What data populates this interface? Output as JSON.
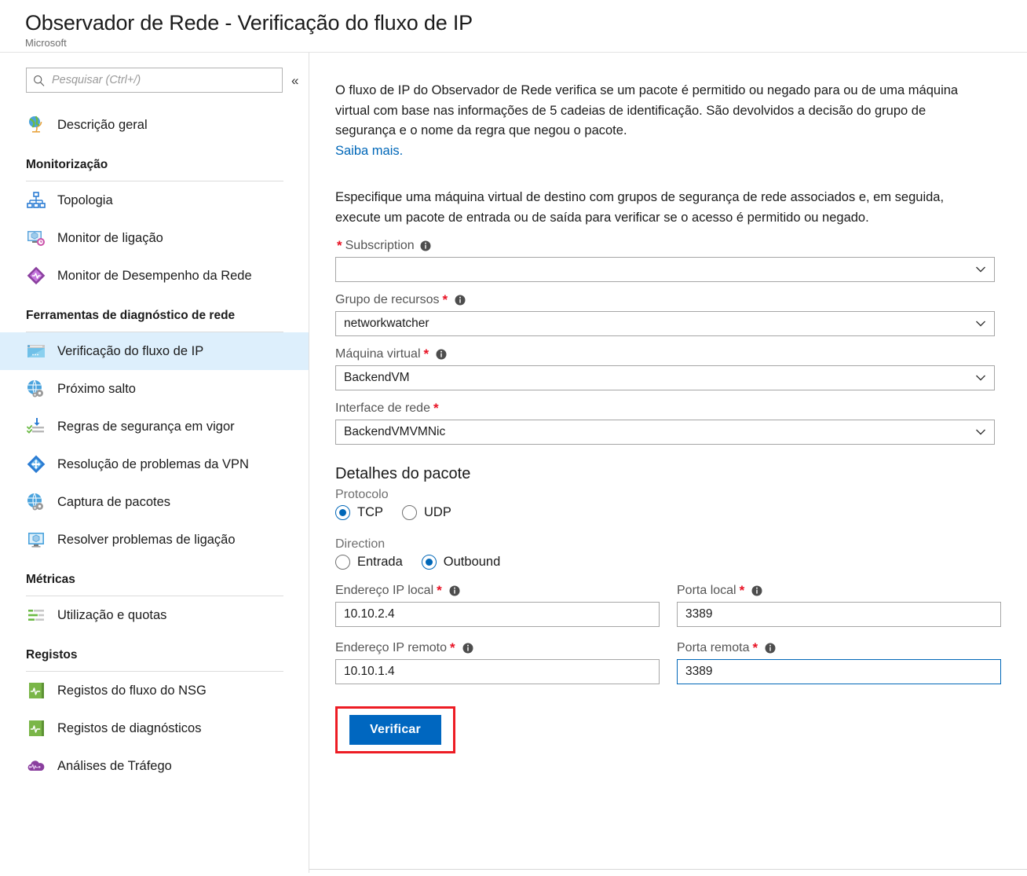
{
  "header": {
    "title": "Observador de Rede - Verificação do fluxo de IP",
    "subtitle": "Microsoft"
  },
  "search": {
    "placeholder": "Pesquisar (Ctrl+/)",
    "icon": "search-icon",
    "collapse_glyph": "«"
  },
  "sidebar": {
    "overview": {
      "label": "Descrição geral",
      "icon": "globe-icon"
    },
    "sections": [
      {
        "title": "Monitorização",
        "items": [
          {
            "label": "Topologia",
            "icon": "topology-icon"
          },
          {
            "label": "Monitor de ligação",
            "icon": "connection-monitor-icon"
          },
          {
            "label": "Monitor de Desempenho da Rede",
            "icon": "network-performance-icon"
          }
        ]
      },
      {
        "title": "Ferramentas de diagnóstico de rede",
        "items": [
          {
            "label": "Verificação do fluxo de IP",
            "icon": "ip-flow-verify-icon",
            "selected": true
          },
          {
            "label": "Próximo salto",
            "icon": "next-hop-icon"
          },
          {
            "label": "Regras de segurança em vigor",
            "icon": "effective-security-rules-icon"
          },
          {
            "label": "Resolução de problemas da VPN",
            "icon": "vpn-troubleshoot-icon"
          },
          {
            "label": "Captura de pacotes",
            "icon": "packet-capture-icon"
          },
          {
            "label": "Resolver problemas de ligação",
            "icon": "connection-troubleshoot-icon"
          }
        ]
      },
      {
        "title": "Métricas",
        "items": [
          {
            "label": "Utilização e quotas",
            "icon": "usage-quotas-icon"
          }
        ]
      },
      {
        "title": "Registos",
        "items": [
          {
            "label": "Registos do fluxo do NSG",
            "icon": "nsg-flow-logs-icon"
          },
          {
            "label": "Registos de diagnósticos",
            "icon": "diagnostic-logs-icon"
          },
          {
            "label": "Análises de Tráfego",
            "icon": "traffic-analytics-icon"
          }
        ]
      }
    ]
  },
  "main": {
    "description_1": "O fluxo de IP do Observador de Rede verifica se um pacote é permitido ou negado para ou de uma máquina virtual com base nas informações de 5 cadeias de identificação. São devolvidos a decisão do grupo de segurança e o nome da regra que negou o pacote.",
    "learn_more": "Saiba mais.",
    "description_2": "Especifique uma máquina virtual de destino com grupos de segurança de rede associados e, em seguida, execute um pacote de entrada ou de saída para verificar se o acesso é permitido ou negado.",
    "fields": {
      "subscription": {
        "label": "Subscription",
        "value": "",
        "required": true,
        "has_info": true,
        "required_before": true
      },
      "resource_group": {
        "label": "Grupo de recursos",
        "value": "networkwatcher",
        "required": true,
        "has_info": true
      },
      "virtual_machine": {
        "label": "Máquina virtual",
        "value": "BackendVM",
        "required": true,
        "has_info": true
      },
      "network_interface": {
        "label": "Interface de rede",
        "value": "BackendVMVMNic",
        "required": true,
        "has_info": false
      }
    },
    "packet_details": {
      "title": "Detalhes do pacote",
      "protocol": {
        "label": "Protocolo",
        "options": [
          {
            "label": "TCP",
            "selected": true
          },
          {
            "label": "UDP",
            "selected": false
          }
        ]
      },
      "direction": {
        "label": "Direction",
        "options": [
          {
            "label": "Entrada",
            "selected": false
          },
          {
            "label": "Outbound",
            "selected": true
          }
        ]
      },
      "local_ip": {
        "label": "Endereço IP local",
        "value": "10.10.2.4",
        "required": true,
        "has_info": true
      },
      "local_port": {
        "label": "Porta local",
        "value": "3389",
        "required": true,
        "has_info": true
      },
      "remote_ip": {
        "label": "Endereço IP remoto",
        "value": "10.10.1.4",
        "required": true,
        "has_info": true
      },
      "remote_port": {
        "label": "Porta remota",
        "value": "3389",
        "required": true,
        "has_info": true,
        "focused": true
      }
    },
    "verify_button": "Verificar"
  },
  "colors": {
    "accent_blue": "#0067b8",
    "button_blue": "#0067c0",
    "highlight_row": "#ddeffc",
    "required_red": "#e81123",
    "annotation_red": "#ed1c24",
    "link_blue": "#0067b8"
  }
}
